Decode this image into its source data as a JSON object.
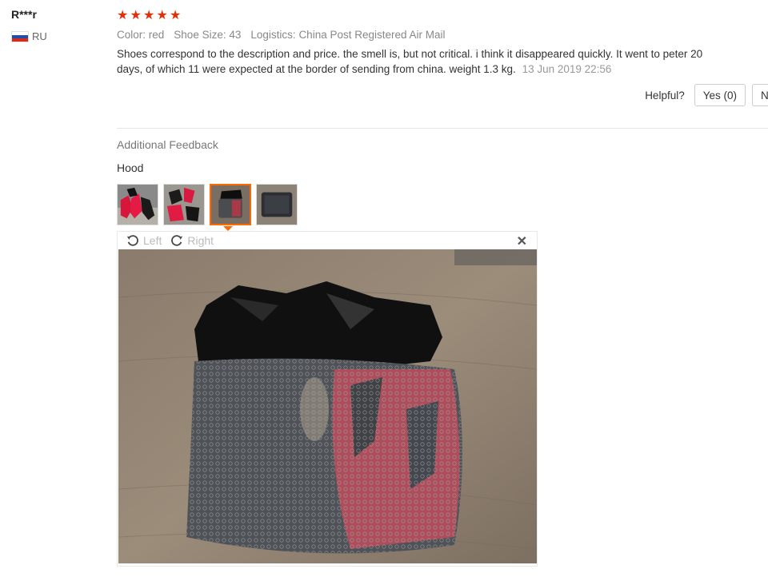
{
  "reviewer": {
    "name": "R***r",
    "country_code": "RU",
    "flag_icon": "russia-flag-icon"
  },
  "review": {
    "rating": 5,
    "rating_max": 5,
    "star_color": "#e62e04",
    "attributes": [
      {
        "label": "Color:",
        "value": "red"
      },
      {
        "label": "Shoe Size:",
        "value": "43"
      },
      {
        "label": "Logistics:",
        "value": "China Post Registered Air Mail"
      }
    ],
    "text": "Shoes correspond to the description and price. the smell is, but not critical. i think it disappeared quickly. It went to peter 20 days, of which 11 were expected at the border of sending from china. weight 1.3 kg.",
    "date": "13 Jun 2019 22:56"
  },
  "helpful": {
    "label": "Helpful?",
    "yes_label": "Yes (0)",
    "no_label": "N"
  },
  "additional_feedback": {
    "title": "Additional Feedback",
    "text": "Hood",
    "thumbnails": [
      {
        "name": "thumbnail-1",
        "active": false
      },
      {
        "name": "thumbnail-2",
        "active": false
      },
      {
        "name": "thumbnail-3",
        "active": true
      },
      {
        "name": "thumbnail-4",
        "active": false
      }
    ],
    "accent_color": "#ff6a00"
  },
  "viewer": {
    "rotate_left_label": "Left",
    "rotate_right_label": "Right",
    "rotate_left_icon": "rotate-left-icon",
    "rotate_right_icon": "rotate-right-icon",
    "close_icon": "close-icon",
    "close_glyph": "✕"
  }
}
